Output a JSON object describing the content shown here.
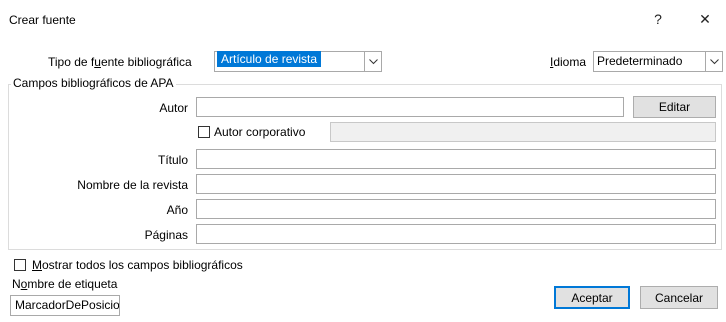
{
  "dialog": {
    "title": "Crear fuente",
    "help": "?",
    "close": "✕"
  },
  "source_type": {
    "label_pre": "Tipo de f",
    "label_ul": "u",
    "label_post": "ente bibliográfica",
    "value": "Artículo de revista"
  },
  "language": {
    "label_ul": "I",
    "label_post": "dioma",
    "value": "Predeterminado"
  },
  "group": {
    "title": "Campos bibliográficos de APA"
  },
  "fields": {
    "autor": "Autor",
    "editar": "Editar",
    "autor_corporativo": "Autor corporativo",
    "titulo": "Título",
    "revista": "Nombre de la revista",
    "anio": "Año",
    "paginas": "Páginas"
  },
  "show_all": {
    "label_ul": "M",
    "label_post": "ostrar todos los campos bibliográficos"
  },
  "tag": {
    "label_pre": "N",
    "label_ul": "o",
    "label_post": "mbre de etiqueta",
    "value": "MarcadorDePosicio"
  },
  "buttons": {
    "accept": "Aceptar",
    "cancel": "Cancelar"
  }
}
